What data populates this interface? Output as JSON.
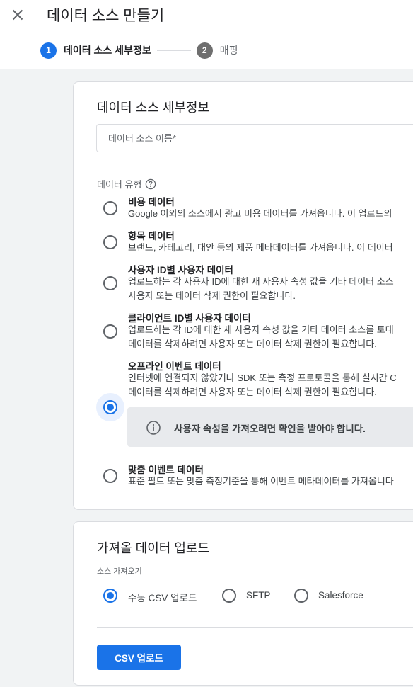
{
  "header": {
    "title": "데이터 소스 만들기",
    "close_icon": "close-icon",
    "steps": [
      {
        "number": "1",
        "label": "데이터 소스 세부정보",
        "active": true
      },
      {
        "number": "2",
        "label": "매핑",
        "active": false
      }
    ]
  },
  "details": {
    "title": "데이터 소스 세부정보",
    "name_placeholder": "데이터 소스 이름*",
    "data_type_label": "데이터 유형",
    "help_icon": "help-circle-icon",
    "options": [
      {
        "title": "비용 데이터",
        "desc": [
          "Google 이외의 소스에서 광고 비용 데이터를 가져옵니다. 이 업로드의"
        ],
        "selected": false
      },
      {
        "title": "항목 데이터",
        "desc": [
          "브랜드, 카테고리, 대안 등의 제품 메타데이터를 가져옵니다. 이 데이터"
        ],
        "selected": false
      },
      {
        "title": "사용자 ID별 사용자 데이터",
        "desc": [
          "업로드하는 각 사용자 ID에 대한 새 사용자 속성 값을 기타 데이터 소스",
          "사용자 또는 데이터 삭제 권한이 필요합니다."
        ],
        "selected": false
      },
      {
        "title": "클라이언트 ID별 사용자 데이터",
        "desc": [
          "업로드하는 각 ID에 대한 새 사용자 속성 값을 기타 데이터 소스를 토대",
          "데이터를 삭제하려면 사용자 또는 데이터 삭제 권한이 필요합니다."
        ],
        "selected": false
      },
      {
        "title": "오프라인 이벤트 데이터",
        "desc": [
          "인터넷에 연결되지 않았거나 SDK 또는 측정 프로토콜을 통해 실시간 C",
          "데이터를 삭제하려면 사용자 또는 데이터 삭제 권한이 필요합니다."
        ],
        "selected": true
      },
      {
        "title": "맞춤 이벤트 데이터",
        "desc": [
          "표준 필드 또는 맞춤 측정기준을 통해 이벤트 메타데이터를 가져옵니다"
        ],
        "selected": false
      }
    ],
    "info": {
      "icon": "info-icon",
      "text": "사용자 속성을 가져오려면 확인을 받아야 합니다."
    }
  },
  "upload": {
    "title": "가져올 데이터 업로드",
    "source_label": "소스 가져오기",
    "sources": [
      {
        "label": "수동 CSV 업로드",
        "selected": true
      },
      {
        "label": "SFTP",
        "selected": false
      },
      {
        "label": "Salesforce",
        "selected": false
      }
    ],
    "button_label": "CSV 업로드"
  },
  "colors": {
    "accent": "#1a73e8",
    "background": "#f1f3f4",
    "info_bg": "#e8eaed"
  }
}
